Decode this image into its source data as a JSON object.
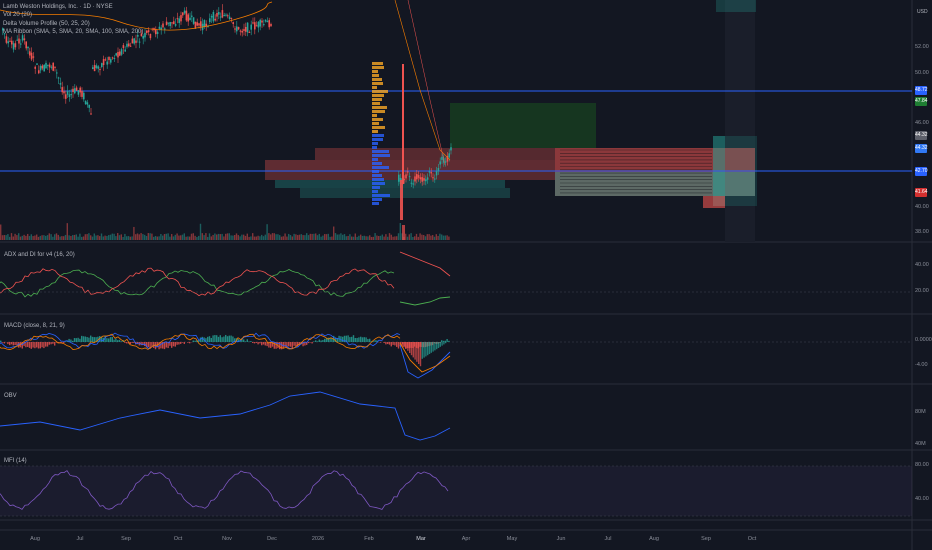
{
  "header": {
    "currency": "USD",
    "legend": [
      "Lamb Weston Holdings, Inc. · 1D · NYSE",
      "Vol 20 (20)",
      "Delta Volume Profile (50, 25, 20)",
      "MA Ribbon (SMA, 5, SMA, 20, SMA, 100, SMA, 200)"
    ]
  },
  "price_axis": {
    "ticks": [
      "52.00",
      "50.00",
      "46.00",
      "44.00",
      "40.00",
      "38.00"
    ],
    "tags": [
      {
        "text": "48.72",
        "color": "#2962ff"
      },
      {
        "text": "47.84",
        "color": "#1e7d32"
      },
      {
        "text": "44.32",
        "color": "#5d606b"
      },
      {
        "text": "44.32",
        "color": "#3179f5"
      },
      {
        "text": "42.70",
        "color": "#2962ff"
      },
      {
        "text": "41.64",
        "color": "#d32f2f"
      }
    ]
  },
  "panes": {
    "adx": {
      "label": "ADX and DI for v4 (16, 20)",
      "ticks": [
        "40.00",
        "20.00"
      ]
    },
    "macd": {
      "label": "MACD (close, 8, 21, 9)",
      "ticks": [
        "0.0000",
        "-4.00"
      ]
    },
    "obv": {
      "label": "OBV",
      "ticks": [
        "80M",
        "40M"
      ]
    },
    "mfi": {
      "label": "MFI (14)",
      "ticks": [
        "80.00",
        "40.00"
      ]
    }
  },
  "time_axis": {
    "ticks": [
      "Aug",
      "Jul",
      "Sep",
      "Oct",
      "Nov",
      "Dec",
      "2026",
      "Feb",
      "Mar",
      "Apr",
      "May",
      "Jun",
      "Jul",
      "Aug",
      "Sep",
      "Oct"
    ]
  },
  "colors": {
    "background": "#131722",
    "up": "#26a69a",
    "down": "#ef5350",
    "line_blue": "#2962ff",
    "adx": "#ef5350",
    "di_plus": "#4caf50",
    "di_minus": "#ef5350"
  }
}
